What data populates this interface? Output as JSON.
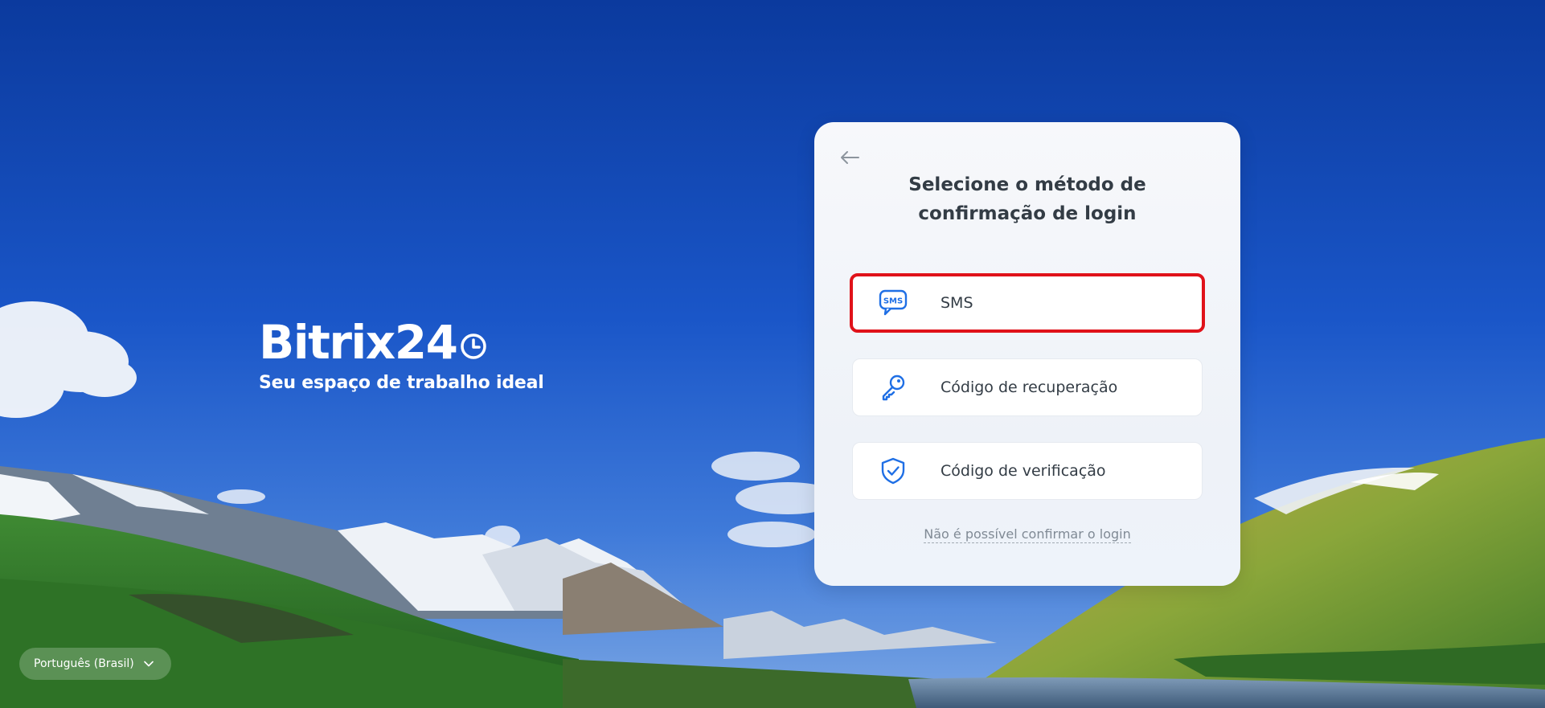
{
  "brand": {
    "name": "Bitrix24",
    "tagline": "Seu espaço de trabalho ideal"
  },
  "dialog": {
    "title": "Selecione o método de confirmação de login",
    "options": [
      {
        "label": "SMS",
        "icon": "sms-icon",
        "selected": true
      },
      {
        "label": "Código de recuperação",
        "icon": "key-icon",
        "selected": false
      },
      {
        "label": "Código de verificação",
        "icon": "shield-check-icon",
        "selected": false
      }
    ],
    "cant_confirm_link": "Não é possível confirmar o login",
    "back_icon": "arrow-left-icon"
  },
  "language": {
    "selected": "Português (Brasil)",
    "icon": "chevron-down-icon"
  },
  "colors": {
    "accent_blue": "#1f6fe5",
    "selection_red": "#e0121a",
    "text_dark": "#333c45",
    "text_muted": "#808a95"
  }
}
